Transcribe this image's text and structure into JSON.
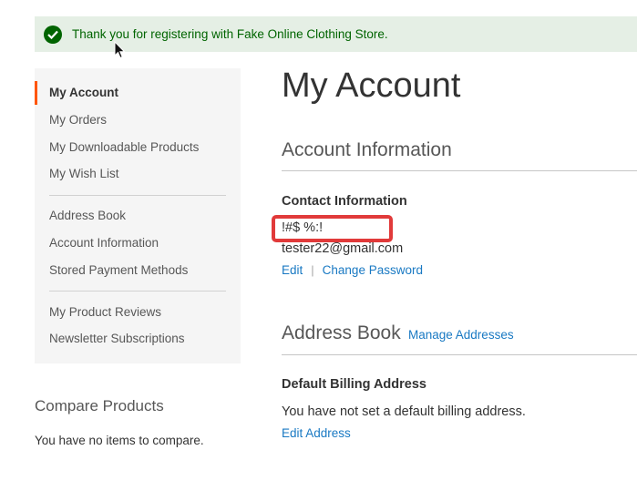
{
  "message": {
    "text": "Thank you for registering with Fake Online Clothing Store.",
    "icon": "checkmark-icon",
    "color": "#006400"
  },
  "sidebar": {
    "items": [
      {
        "label": "My Account",
        "active": true
      },
      {
        "label": "My Orders"
      },
      {
        "label": "My Downloadable Products"
      },
      {
        "label": "My Wish List"
      },
      {
        "label": "Address Book"
      },
      {
        "label": "Account Information"
      },
      {
        "label": "Stored Payment Methods"
      },
      {
        "label": "My Product Reviews"
      },
      {
        "label": "Newsletter Subscriptions"
      }
    ]
  },
  "compare": {
    "title": "Compare Products",
    "empty_text": "You have no items to compare."
  },
  "main": {
    "page_title": "My Account",
    "account_info": {
      "title": "Account Information",
      "contact_title": "Contact Information",
      "name": "!#$ %:!",
      "email": "tester22@gmail.com",
      "edit_label": "Edit",
      "separator": "|",
      "change_password_label": "Change Password"
    },
    "address_book": {
      "title": "Address Book",
      "manage_label": "Manage Addresses",
      "billing_title": "Default Billing Address",
      "billing_text": "You have not set a default billing address.",
      "edit_address_label": "Edit Address"
    }
  },
  "colors": {
    "accent_active": "#ff5501",
    "link": "#1979c3",
    "highlight": "#e13a3a"
  }
}
